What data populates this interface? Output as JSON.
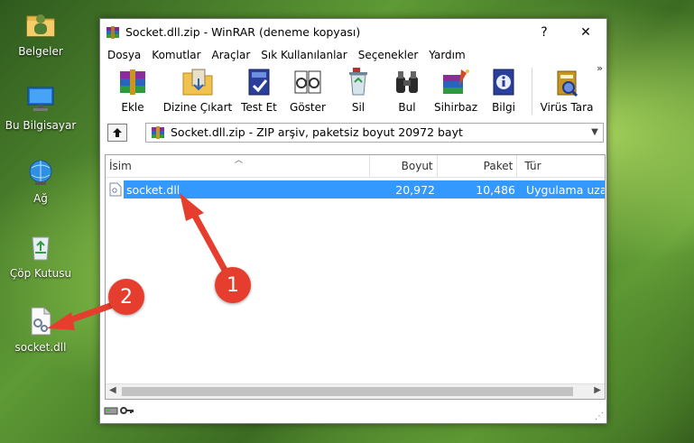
{
  "desktop": {
    "icons": [
      {
        "label": "Belgeler"
      },
      {
        "label": "Bu Bilgisayar"
      },
      {
        "label": "Ağ"
      },
      {
        "label": "Çöp Kutusu"
      },
      {
        "label": "socket.dll"
      }
    ]
  },
  "window": {
    "title": "Socket.dll.zip - WinRAR (deneme kopyası)",
    "help_label": "?",
    "close_label": "✕"
  },
  "menu": [
    "Dosya",
    "Komutlar",
    "Araçlar",
    "Sık Kullanılanlar",
    "Seçenekler",
    "Yardım"
  ],
  "toolbar": {
    "buttons": [
      {
        "label": "Ekle",
        "icon": "add-archive-icon"
      },
      {
        "label": "Dizine Çıkart",
        "icon": "extract-to-icon"
      },
      {
        "label": "Test Et",
        "icon": "test-icon"
      },
      {
        "label": "Göster",
        "icon": "view-icon"
      },
      {
        "label": "Sil",
        "icon": "delete-icon"
      },
      {
        "label": "Bul",
        "icon": "find-icon"
      },
      {
        "label": "Sihirbaz",
        "icon": "wizard-icon"
      },
      {
        "label": "Bilgi",
        "icon": "info-icon"
      },
      {
        "label": "Virüs Tara",
        "icon": "virus-scan-icon"
      }
    ],
    "more": "»"
  },
  "pathbar": {
    "path": "Socket.dll.zip - ZIP arşiv, paketsiz boyut 20972 bayt"
  },
  "columns": [
    "İsim",
    "Boyut",
    "Paket",
    "Tür"
  ],
  "files": [
    {
      "name": "socket.dll",
      "size": "20,972",
      "packed": "10,486",
      "type": "Uygulama uzantısı"
    }
  ],
  "annotations": [
    "1",
    "2"
  ],
  "colors": {
    "selection": "#3399ff",
    "annotation_red": "#e53e2e"
  }
}
